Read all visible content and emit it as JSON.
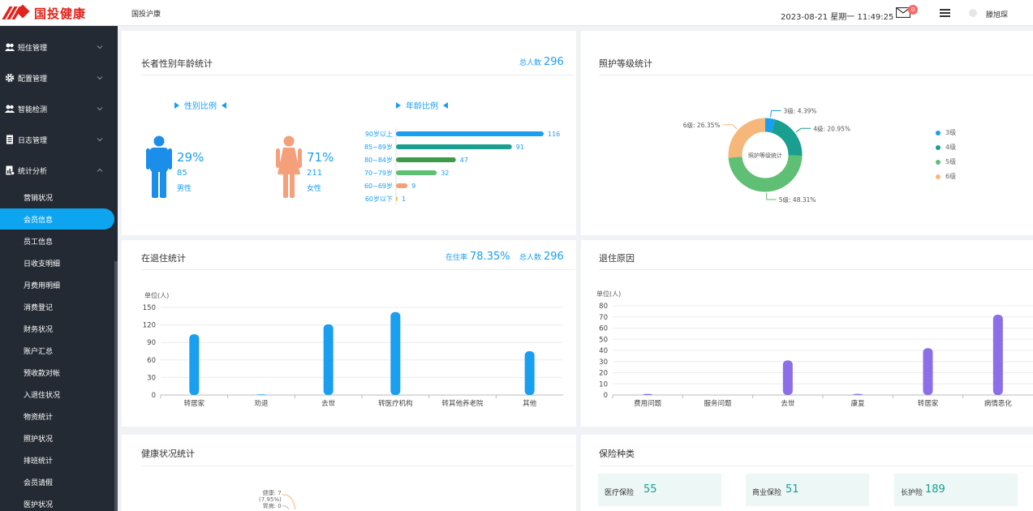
{
  "header": {
    "logo_text": "国投健康",
    "app_title": "国投沪康",
    "datetime": "2023-08-21 星期一 11:49:25",
    "mail_count": "0",
    "username": "滕旭琛"
  },
  "sidebar": {
    "groups": [
      {
        "label": "短住管理",
        "icon": "people-icon"
      },
      {
        "label": "配置管理",
        "icon": "gear-icon"
      },
      {
        "label": "智能检测",
        "icon": "people-icon"
      },
      {
        "label": "日志管理",
        "icon": "document-icon"
      },
      {
        "label": "统计分析",
        "icon": "chart-doc-icon"
      }
    ],
    "items": [
      {
        "label": "营销状况"
      },
      {
        "label": "会员信息",
        "active": true
      },
      {
        "label": "员工信息"
      },
      {
        "label": "日收支明细"
      },
      {
        "label": "月费用明细"
      },
      {
        "label": "消费登记"
      },
      {
        "label": "财务状况"
      },
      {
        "label": "账户汇总"
      },
      {
        "label": "预收款对帐"
      },
      {
        "label": "入退住状况"
      },
      {
        "label": "物资统计"
      },
      {
        "label": "照护状况"
      },
      {
        "label": "排班统计"
      },
      {
        "label": "会员请假"
      },
      {
        "label": "医护状况"
      }
    ]
  },
  "colors": {
    "accent": "#1a9ef0",
    "male": "#1a8ee8",
    "female": "#f5a07a",
    "sidebar_bg": "#242a33",
    "active": "#0da5f0",
    "teal": "#1a9e8f"
  },
  "elderly_panel": {
    "title": "长者性别年龄统计",
    "total_label": "总人数",
    "total_value": "296",
    "gender_heading": "性别比例",
    "age_heading": "年龄比例",
    "male": {
      "percent": "29%",
      "count": "85",
      "label": "男性",
      "icon": "male-person-icon"
    },
    "female": {
      "percent": "71%",
      "count": "211",
      "label": "女性",
      "icon": "female-person-icon"
    },
    "age_bars": [
      {
        "label": "90岁以上",
        "value": 116,
        "color": "#1a9ef0"
      },
      {
        "label": "85~89岁",
        "value": 91,
        "color": "#1a9e8f"
      },
      {
        "label": "80~84岁",
        "value": 47,
        "color": "#3f9a4c"
      },
      {
        "label": "70~79岁",
        "value": 32,
        "color": "#5fbf75"
      },
      {
        "label": "60~69岁",
        "value": 9,
        "color": "#f5a07a"
      },
      {
        "label": "60岁以下",
        "value": 1,
        "color": "#f5c242"
      }
    ]
  },
  "care_panel": {
    "title": "照护等级统计",
    "center_label": "照护等级统计"
  },
  "residency_panel": {
    "title": "在退住统计",
    "rate_label": "在住率",
    "rate_value": "78.35%",
    "total_label": "总人数",
    "total_value": "296"
  },
  "reason_panel": {
    "title": "退住原因"
  },
  "health_panel": {
    "title": "健康状况统计",
    "labels": [
      "健康: 7",
      "(7.95%)",
      "胃病: 0"
    ]
  },
  "insurance_panel": {
    "title": "保险种类",
    "cards": [
      {
        "label": "医疗保险",
        "value": "55"
      },
      {
        "label": "商业保险",
        "value": "51"
      },
      {
        "label": "长护险",
        "value": "189"
      }
    ]
  },
  "chart_data": [
    {
      "type": "pie",
      "title": "照护等级统计",
      "slices": [
        {
          "name": "3级",
          "value": 4.39,
          "label": "3级: 4.39%",
          "color": "#1a9ef0"
        },
        {
          "name": "4级",
          "value": 20.95,
          "label": "4级: 20.95%",
          "color": "#1a9e8f"
        },
        {
          "name": "5级",
          "value": 48.31,
          "label": "5级: 48.31%",
          "color": "#5fbf75"
        },
        {
          "name": "6级",
          "value": 26.35,
          "label": "6级: 26.35%",
          "color": "#f5b87a"
        }
      ],
      "legend": [
        "3级",
        "4级",
        "5级",
        "6级"
      ],
      "legend_position": "right"
    },
    {
      "type": "bar",
      "title": "在退住统计",
      "ylabel": "单位(人)",
      "ylim": [
        0,
        150
      ],
      "yticks": [
        "0",
        "30",
        "60",
        "90",
        "120",
        "150"
      ],
      "categories": [
        "转居家",
        "劝退",
        "去世",
        "转医疗机构",
        "转其他养老院",
        "其他"
      ],
      "values": [
        104,
        1,
        121,
        142,
        0,
        75
      ],
      "color": "#1a9ef0"
    },
    {
      "type": "bar",
      "title": "退住原因",
      "ylabel": "单位(人)",
      "ylim": [
        0,
        80
      ],
      "yticks": [
        "0",
        "10",
        "20",
        "30",
        "40",
        "50",
        "60",
        "70",
        "80"
      ],
      "categories": [
        "费用问题",
        "服务问题",
        "去世",
        "康复",
        "转居家",
        "病情恶化"
      ],
      "values": [
        1,
        0,
        31,
        1,
        42,
        72
      ],
      "color": "#8c6ee8"
    }
  ]
}
